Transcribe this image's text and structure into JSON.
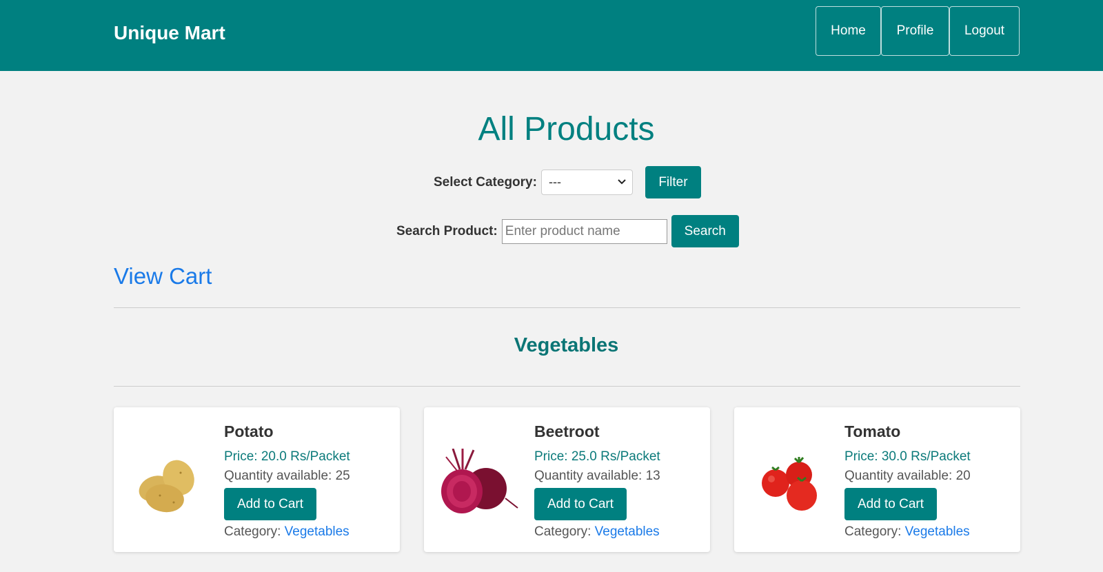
{
  "navbar": {
    "brand": "Unique Mart",
    "links": [
      "Home",
      "Profile",
      "Logout"
    ]
  },
  "page_title": "All Products",
  "filter": {
    "label": "Select Category:",
    "selected": "---",
    "button": "Filter"
  },
  "search": {
    "label": "Search Product:",
    "placeholder": "Enter product name",
    "value": "",
    "button": "Search"
  },
  "view_cart": "View Cart",
  "section": {
    "title": "Vegetables"
  },
  "products": [
    {
      "name": "Potato",
      "price": "Price: 20.0 Rs/Packet",
      "qty_label": "Quantity available:",
      "qty": "25",
      "button": "Add to Cart",
      "category_label": "Category:",
      "category": "Vegetables"
    },
    {
      "name": "Beetroot",
      "price": "Price: 25.0 Rs/Packet",
      "qty_label": "Quantity available:",
      "qty": "13",
      "button": "Add to Cart",
      "category_label": "Category:",
      "category": "Vegetables"
    },
    {
      "name": "Tomato",
      "price": "Price: 30.0 Rs/Packet",
      "qty_label": "Quantity available:",
      "qty": "20",
      "button": "Add to Cart",
      "category_label": "Category:",
      "category": "Vegetables"
    }
  ],
  "colors": {
    "primary": "#008080",
    "link": "#1a7ae8",
    "background": "#f2f2f2"
  }
}
